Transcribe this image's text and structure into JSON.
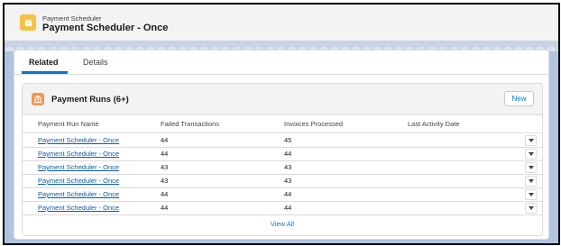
{
  "header": {
    "object_type": "Payment Scheduler",
    "record_title": "Payment Scheduler - Once",
    "icon": "scheduler-icon"
  },
  "tabs": [
    {
      "label": "Related",
      "active": true
    },
    {
      "label": "Details",
      "active": false
    }
  ],
  "payment_runs": {
    "title": "Payment Runs (6+)",
    "icon": "bank-icon",
    "new_label": "New",
    "columns": [
      "Payment Run Name",
      "Failed Transactions",
      "Invoices Processed",
      "Last Activity Date"
    ],
    "rows": [
      {
        "name": "Payment Scheduler - Once",
        "failed": "44",
        "processed": "45",
        "last_activity": ""
      },
      {
        "name": "Payment Scheduler - Once",
        "failed": "44",
        "processed": "44",
        "last_activity": ""
      },
      {
        "name": "Payment Scheduler - Once",
        "failed": "43",
        "processed": "43",
        "last_activity": ""
      },
      {
        "name": "Payment Scheduler - Once",
        "failed": "43",
        "processed": "43",
        "last_activity": ""
      },
      {
        "name": "Payment Scheduler - Once",
        "failed": "44",
        "processed": "44",
        "last_activity": ""
      },
      {
        "name": "Payment Scheduler - Once",
        "failed": "44",
        "processed": "44",
        "last_activity": ""
      }
    ],
    "view_all_label": "View All"
  },
  "colors": {
    "brand_blue": "#0176d3",
    "header_icon": "#f4c144",
    "card_icon": "#f49756",
    "background": "#b0c4df"
  }
}
